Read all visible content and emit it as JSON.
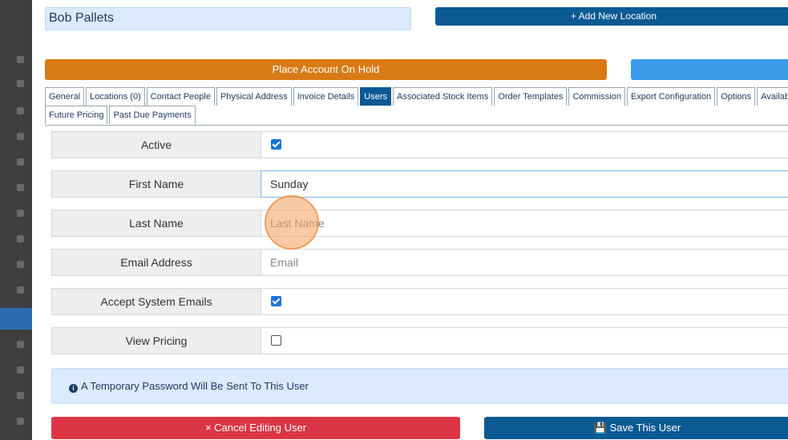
{
  "account": {
    "name": "Bob Pallets"
  },
  "actions": {
    "add_location": "+ Add New Location",
    "place_on_hold": "Place Account On Hold"
  },
  "tabs": [
    {
      "label": "General",
      "active": false
    },
    {
      "label": "Locations (0)",
      "active": false
    },
    {
      "label": "Contact People",
      "active": false
    },
    {
      "label": "Physical Address",
      "active": false
    },
    {
      "label": "Invoice Details",
      "active": false
    },
    {
      "label": "Users",
      "active": true
    },
    {
      "label": "Associated Stock Items",
      "active": false
    },
    {
      "label": "Order Templates",
      "active": false
    },
    {
      "label": "Commission",
      "active": false
    },
    {
      "label": "Export Configuration",
      "active": false
    },
    {
      "label": "Options",
      "active": false
    },
    {
      "label": "Available Facilities",
      "active": false
    },
    {
      "label": "Future Pricing",
      "active": false
    },
    {
      "label": "Past Due Payments",
      "active": false
    }
  ],
  "form": {
    "active": {
      "label": "Active",
      "checked": true
    },
    "first_name": {
      "label": "First Name",
      "value": "Sunday",
      "placeholder": "First Name"
    },
    "last_name": {
      "label": "Last Name",
      "value": "",
      "placeholder": "Last Name"
    },
    "email": {
      "label": "Email Address",
      "value": "",
      "placeholder": "Email"
    },
    "accept_emails": {
      "label": "Accept System Emails",
      "checked": true
    },
    "view_pricing": {
      "label": "View Pricing",
      "checked": false
    }
  },
  "info": {
    "icon": "info-circle-icon",
    "message": "A Temporary Password Will Be Sent To This User"
  },
  "footer": {
    "cancel_label": "× Cancel Editing User",
    "save_label": "Save This User"
  },
  "colors": {
    "primary": "#0b5a94",
    "warning": "#d97a14",
    "danger": "#dc3545",
    "info_bg": "#dbeafc"
  }
}
